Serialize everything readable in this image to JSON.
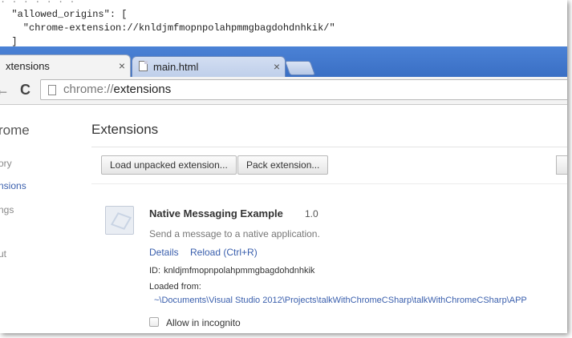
{
  "code": {
    "line1": "  \"allowed_origins\": [",
    "line2": "    \"chrome-extension://knldjmfmopnpolahpmmgbagdohdnhkik/\"",
    "line3": "  ]"
  },
  "tabs": [
    {
      "title": "xtensions",
      "close": "×",
      "active": true
    },
    {
      "title": "main.html",
      "close": "×",
      "active": false
    }
  ],
  "toolbar": {
    "back_glyph": "←",
    "reload_glyph": "C",
    "url_scheme": "chrome://",
    "url_path": "extensions"
  },
  "sidebar": {
    "title": "rome",
    "items": [
      {
        "label": "ory"
      },
      {
        "label": "nsions"
      },
      {
        "label": "ngs"
      },
      {
        "label": "ut"
      }
    ]
  },
  "main": {
    "title": "Extensions",
    "load_unpacked_label": "Load unpacked extension...",
    "pack_label": "Pack extension..."
  },
  "extension": {
    "name": "Native Messaging Example",
    "version": "1.0",
    "description": "Send a message to a native application.",
    "details_link": "Details",
    "reload_link": "Reload (Ctrl+R)",
    "id_label": "ID:",
    "id_value": "knldjmfmopnpolahpmmgbagdohdnhkik",
    "loaded_from_label": "Loaded from:",
    "loaded_from_path": "~\\Documents\\Visual Studio 2012\\Projects\\talkWithChromeCSharp\\talkWithChromeCSharp\\APP",
    "incognito_label": "Allow in incognito",
    "incognito_checked": false
  },
  "colors": {
    "tabstrip": "#3a6fc4",
    "link": "#3a5fad"
  }
}
